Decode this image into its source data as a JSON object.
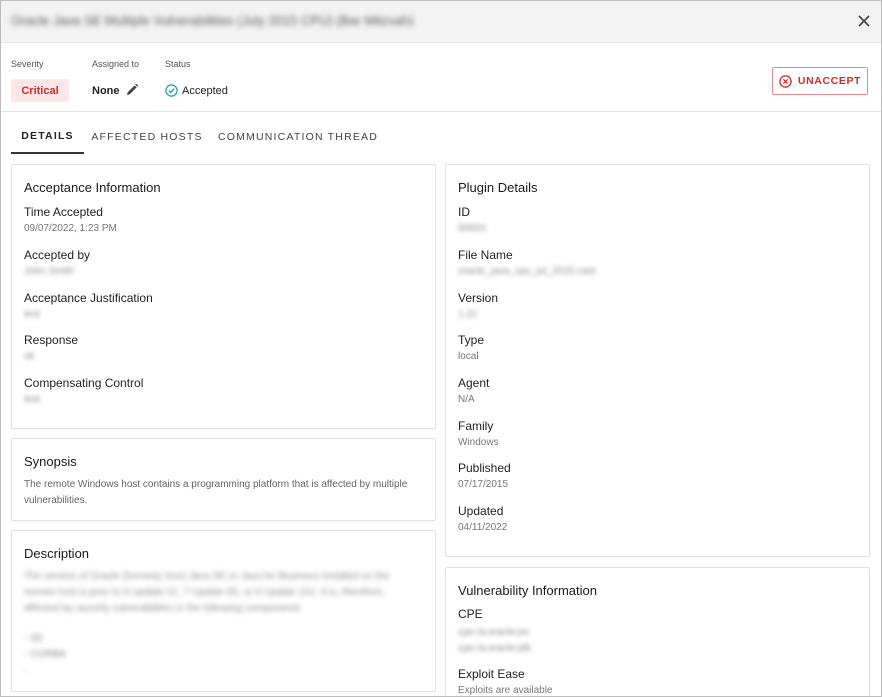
{
  "dialog": {
    "title": "Oracle Java SE Multiple Vulnerabilities (July 2015 CPU) (Bar Mitzvah)"
  },
  "meta": {
    "severity_label": "Severity",
    "severity_value": "Critical",
    "assigned_label": "Assigned to",
    "assigned_value": "None",
    "status_label": "Status",
    "status_value": "Accepted",
    "unaccept_label": "UNACCEPT"
  },
  "tabs": [
    {
      "label": "DETAILS"
    },
    {
      "label": "AFFECTED HOSTS"
    },
    {
      "label": "COMMUNICATION THREAD"
    }
  ],
  "acceptance": {
    "title": "Acceptance Information",
    "time_label": "Time Accepted",
    "time_value": "09/07/2022, 1:23 PM",
    "by_label": "Accepted by",
    "by_value": "John Smith",
    "justification_label": "Acceptance Justification",
    "justification_value": "test",
    "response_label": "Response",
    "response_value": "ok",
    "control_label": "Compensating Control",
    "control_value": "test"
  },
  "synopsis": {
    "title": "Synopsis",
    "text": "The remote Windows host contains a programming platform that is affected by multiple vulnerabilities."
  },
  "description": {
    "title": "Description",
    "text": "The version of Oracle (formerly Sun) Java SE or Java for Business installed on the remote host is prior to 8 Update 51, 7 Update 85, or 6 Update 101. It is, therefore, affected by security vulnerabilities in the following components:",
    "item1": "- 2D",
    "item2": "- CORBA",
    "item3": "-"
  },
  "plugin": {
    "title": "Plugin Details",
    "id_label": "ID",
    "id_value": "84824",
    "file_label": "File Name",
    "file_value": "oracle_java_cpu_jul_2015.nasl",
    "version_label": "Version",
    "version_value": "1.21",
    "type_label": "Type",
    "type_value": "local",
    "agent_label": "Agent",
    "agent_value": "N/A",
    "family_label": "Family",
    "family_value": "Windows",
    "published_label": "Published",
    "published_value": "07/17/2015",
    "updated_label": "Updated",
    "updated_value": "04/11/2022"
  },
  "vuln": {
    "title": "Vulnerability Information",
    "cpe_label": "CPE",
    "cpe_value1": "cpe:/a:oracle:jre",
    "cpe_value2": "cpe:/a:oracle:jdk",
    "exploit_label": "Exploit Ease",
    "exploit_value": "Exploits are available"
  }
}
